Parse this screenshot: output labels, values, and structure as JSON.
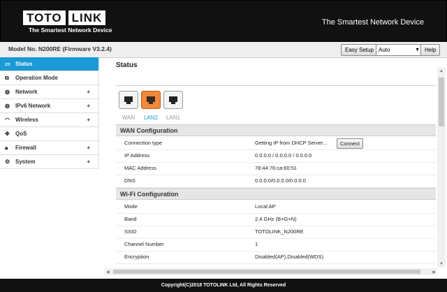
{
  "header": {
    "logo_left": "TOTO",
    "logo_right": "LINK",
    "logo_tagline": "The Smartest Network Device",
    "slogan": "The Smartest Network Device"
  },
  "topbar": {
    "model": "Model No. N200RE (Firmware V3.2.4)",
    "easy_setup": "Easy Setup",
    "language": "Auto",
    "help": "Help"
  },
  "sidebar": {
    "items": [
      {
        "label": "Status",
        "icon": "monitor-icon",
        "active": true
      },
      {
        "label": "Operation Mode",
        "icon": "window-icon"
      },
      {
        "label": "Network",
        "icon": "globe-icon",
        "expandable": true
      },
      {
        "label": "IPv6 Network",
        "icon": "globe-icon",
        "expandable": true
      },
      {
        "label": "Wireless",
        "icon": "wifi-icon",
        "expandable": true
      },
      {
        "label": "QoS",
        "icon": "qos-icon"
      },
      {
        "label": "Firewall",
        "icon": "lock-icon",
        "expandable": true
      },
      {
        "label": "System",
        "icon": "gear-icon",
        "expandable": true
      }
    ],
    "expand_symbol": "+"
  },
  "main": {
    "title": "Status",
    "ports": [
      {
        "label": "WAN",
        "active": false
      },
      {
        "label": "LAN2",
        "active": true
      },
      {
        "label": "LAN1",
        "active": false
      }
    ],
    "wan": {
      "title": "WAN Configuration",
      "connect_label": "Connect",
      "rows": [
        {
          "key": "Connection type",
          "value": "Getting IP from DHCP Server..."
        },
        {
          "key": "IP Address",
          "value": "0.0.0.0 / 0.0.0.0 / 0.0.0.0"
        },
        {
          "key": "MAC Address",
          "value": "78:44:76:ca:60:51"
        },
        {
          "key": "DNS",
          "value": "0.0.0.0/0.0.0.0/0.0.0.0"
        }
      ]
    },
    "wifi": {
      "title": "Wi-Fi Configuration",
      "rows": [
        {
          "key": "Mode",
          "value": "Local AP"
        },
        {
          "key": "Band",
          "value": "2.4 GHz (B+G+N)"
        },
        {
          "key": "SSID",
          "value": "TOTOLINK_N200RE"
        },
        {
          "key": "Channel Number",
          "value": "1"
        },
        {
          "key": "Encryption",
          "value": "Disabled(AP),Disabled(WDS)"
        }
      ]
    }
  },
  "footer": {
    "copyright": "Copyright(C)2018 TOTOLINK Ltd, All Rights Reserved"
  },
  "colors": {
    "accent": "#1a9ad6",
    "port_active": "#ef8a3c",
    "header_bg": "#111111"
  }
}
